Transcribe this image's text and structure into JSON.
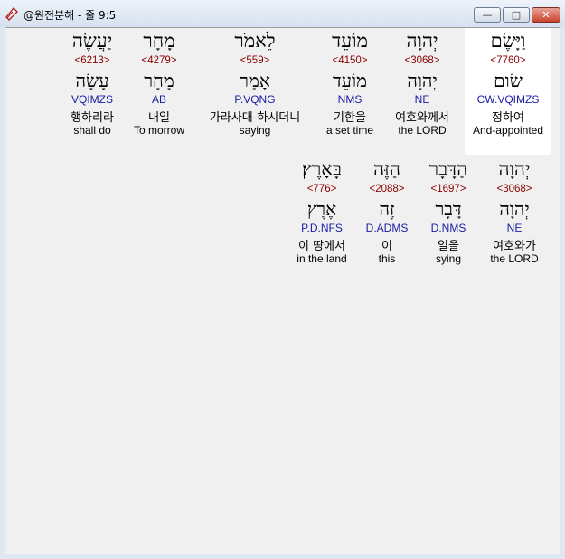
{
  "window": {
    "title": "@원전분해 - 줄 9:5",
    "buttons": {
      "minimize": "—",
      "maximize": "□",
      "close": "✕"
    }
  },
  "lines": [
    [
      {
        "heb": "וַיָּשֶׂם",
        "num": "<7760>",
        "heb2": "שׂום",
        "morph": "CW.VQIMZS",
        "kor": "정하여",
        "eng": "And-appointed",
        "highlight": true
      },
      {
        "heb": "יְהוָה",
        "num": "<3068>",
        "heb2": "יְהוָה",
        "morph": "NE",
        "kor": "여호와께서",
        "eng": "the LORD"
      },
      {
        "heb": "מוֹעֵד",
        "num": "<4150>",
        "heb2": "מוֹעֵד",
        "morph": "NMS",
        "kor": "기한을",
        "eng": "a set time"
      },
      {
        "heb": "לֵאמֹר",
        "num": "<559>",
        "heb2": "אָמַר",
        "morph": "P.VQNG",
        "kor": "가라사대-하시더니",
        "eng": "saying"
      },
      {
        "heb": "מָחָר",
        "num": "<4279>",
        "heb2": "מָחָר",
        "morph": "AB",
        "kor": "내일",
        "eng": "To morrow"
      },
      {
        "heb": "יַעֲשֶׂה",
        "num": "<6213>",
        "heb2": "עָשָׂה",
        "morph": "VQIMZS",
        "kor": "행하리라",
        "eng": "shall do"
      }
    ],
    [
      {
        "heb": "יְהוָה",
        "num": "<3068>",
        "heb2": "יְהוָה",
        "morph": "NE",
        "kor": "여호와가",
        "eng": "the LORD"
      },
      {
        "heb": "הַדָּבָר",
        "num": "<1697>",
        "heb2": "דָּבָר",
        "morph": "D.NMS",
        "kor": "일을",
        "eng": "sying"
      },
      {
        "heb": "הַזֶּה",
        "num": "<2088>",
        "heb2": "זֶה",
        "morph": "D.ADMS",
        "kor": "이",
        "eng": "this"
      },
      {
        "heb": "בָּאָרֶץ׃",
        "num": "<776>",
        "heb2": "אֶרֶץ",
        "morph": "P.D.NFS",
        "kor": "이 땅에서",
        "eng": "in the land"
      }
    ]
  ]
}
